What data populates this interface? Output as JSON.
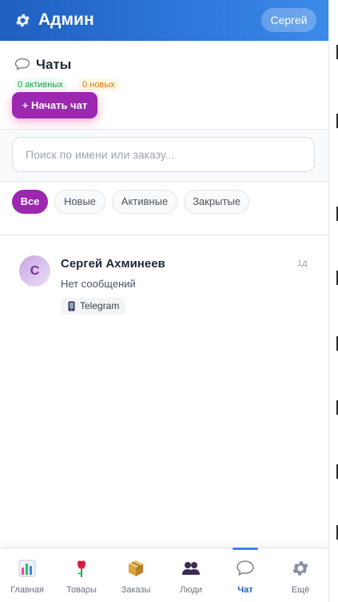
{
  "header": {
    "title": "Админ",
    "user_label": "Сергей",
    "icon": "gear-icon"
  },
  "chats": {
    "title": "Чаты",
    "title_icon": "speech-bubble-icon",
    "badge_active": "0 активных",
    "badge_new": "0 новых",
    "start_button": "+ Начать чат",
    "accent": "#9c27b0"
  },
  "search": {
    "placeholder": "Поиск по имени или заказу..."
  },
  "filters": [
    {
      "label": "Все",
      "active": true
    },
    {
      "label": "Новые",
      "active": false
    },
    {
      "label": "Активные",
      "active": false
    },
    {
      "label": "Закрытые",
      "active": false
    }
  ],
  "chat_list": [
    {
      "initial": "С",
      "name": "Сергей Ахминеев",
      "time": "1д",
      "last_message": "Нет сообщений",
      "channel": "Telegram",
      "channel_icon": "phone-icon"
    }
  ],
  "bottom_nav": [
    {
      "label": "Главная",
      "icon": "chart-icon",
      "active": false
    },
    {
      "label": "Товары",
      "icon": "rose-icon",
      "active": false
    },
    {
      "label": "Заказы",
      "icon": "package-icon",
      "active": false
    },
    {
      "label": "Люди",
      "icon": "people-icon",
      "active": false
    },
    {
      "label": "Чат",
      "icon": "speech-bubble-icon",
      "active": true
    },
    {
      "label": "Ещё",
      "icon": "gear-icon",
      "active": false
    }
  ]
}
